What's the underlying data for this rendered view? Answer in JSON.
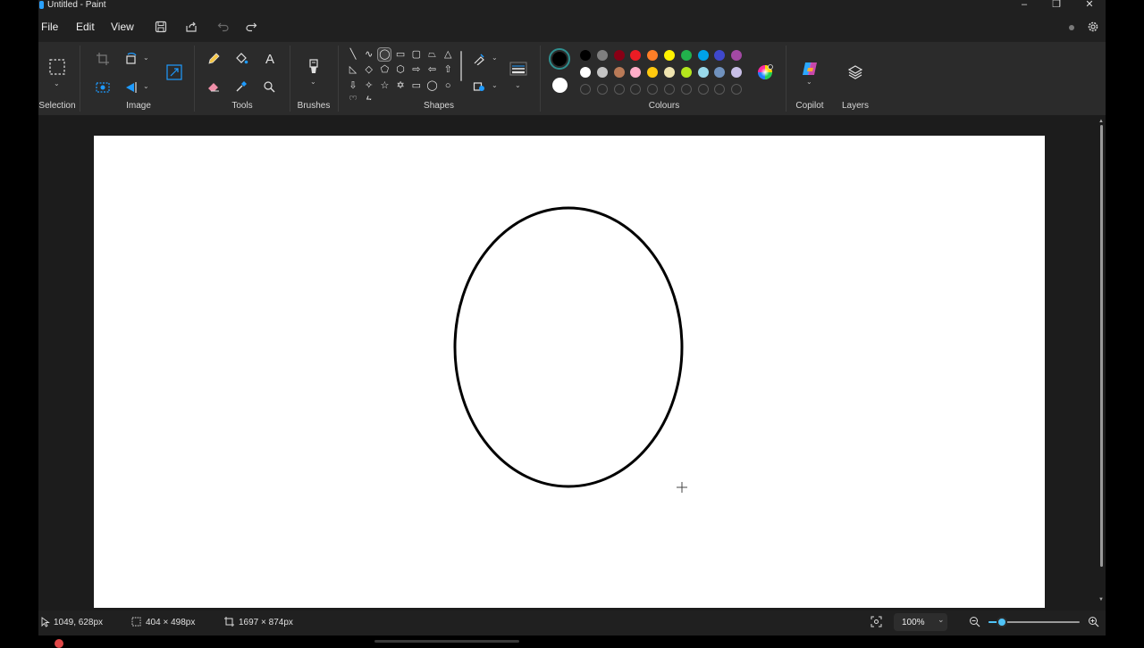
{
  "window": {
    "title": "Untitled - Paint",
    "minimize": "–",
    "restore": "❐",
    "close": "✕"
  },
  "menu": {
    "file": "File",
    "edit": "Edit",
    "view": "View"
  },
  "ribbon": {
    "groups": {
      "selection": "Selection",
      "image": "Image",
      "tools": "Tools",
      "brushes": "Brushes",
      "shapes": "Shapes",
      "colours": "Colours",
      "copilot": "Copilot",
      "layers": "Layers"
    },
    "text_tool": "A"
  },
  "colours": {
    "primary": "#000000",
    "secondary": "#ffffff",
    "row1": [
      "#000000",
      "#7f7f7f",
      "#880015",
      "#ed1c24",
      "#ff7f27",
      "#fff200",
      "#22b14c",
      "#00a2e8",
      "#3f48cc",
      "#a349a4"
    ],
    "row2": [
      "#ffffff",
      "#c3c3c3",
      "#b97a57",
      "#ffaec9",
      "#ffc90e",
      "#efe4b0",
      "#b5e61d",
      "#99d9ea",
      "#7092be",
      "#c8bfe7"
    ]
  },
  "status": {
    "cursor_pos": "1049, 628px",
    "selection_size": "404 × 498px",
    "canvas_size": "1697 × 874px",
    "zoom": "100%",
    "zoom_level": 0.15
  }
}
